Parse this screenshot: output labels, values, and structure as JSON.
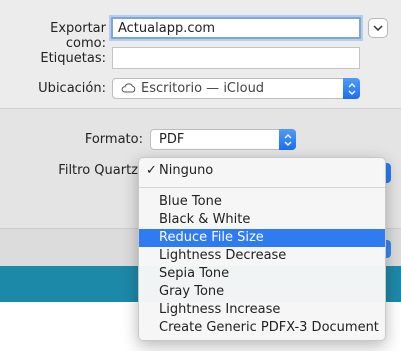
{
  "save_dialog": {
    "export_as_label": "Exportar como:",
    "export_as_value": "Actualapp.com",
    "tags_label": "Etiquetas:",
    "tags_value": "",
    "location_label": "Ubicación:",
    "location_value": "Escritorio — iCloud"
  },
  "options": {
    "format_label": "Formato:",
    "format_value": "PDF",
    "quartz_filter_label": "Filtro Quartz"
  },
  "quartz_menu": {
    "items": [
      "Ninguno",
      "Blue Tone",
      "Black & White",
      "Reduce File Size",
      "Lightness Decrease",
      "Sepia Tone",
      "Gray Tone",
      "Lightness Increase",
      "Create Generic PDFX-3 Document"
    ],
    "checked": "Ninguno",
    "highlighted": "Reduce File Size",
    "check_glyph": "✓"
  },
  "icons": {
    "expand": "chevron-down-icon",
    "location": "cloud-icon",
    "popup": "updown-arrows-icon"
  },
  "colors": {
    "accent": "#2f7bf2",
    "teal": "#1d89a8"
  }
}
